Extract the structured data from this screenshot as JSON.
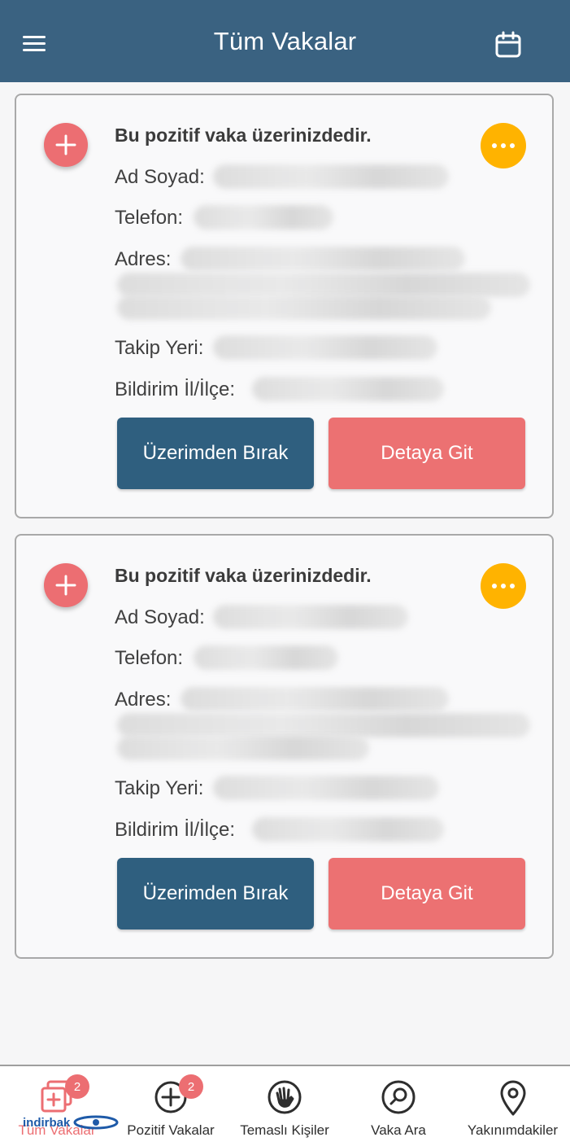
{
  "header": {
    "title": "Tüm Vakalar"
  },
  "cases": [
    {
      "status": "Bu pozitif vaka üzerinizdedir.",
      "labels": {
        "name": "Ad Soyad:",
        "phone": "Telefon:",
        "address": "Adres:",
        "tracking": "Takip Yeri:",
        "notify": "Bildirim İl/İlçe:"
      },
      "release_label": "Üzerimden Bırak",
      "detail_label": "Detaya Git"
    },
    {
      "status": "Bu pozitif vaka üzerinizdedir.",
      "labels": {
        "name": "Ad Soyad:",
        "phone": "Telefon:",
        "address": "Adres:",
        "tracking": "Takip Yeri:",
        "notify": "Bildirim İl/İlçe:"
      },
      "release_label": "Üzerimden Bırak",
      "detail_label": "Detaya Git"
    }
  ],
  "tabs": [
    {
      "label": "Tüm Vakalar",
      "badge": "2",
      "icon": "stacked-plus-icon",
      "active": true
    },
    {
      "label": "Pozitif Vakalar",
      "badge": "2",
      "icon": "circle-plus-icon"
    },
    {
      "label": "Temaslı Kişiler",
      "icon": "hand-icon"
    },
    {
      "label": "Vaka Ara",
      "icon": "search-icon"
    },
    {
      "label": "Yakınımdakiler",
      "icon": "location-pin-icon"
    }
  ],
  "watermark": {
    "text": "indirbak"
  },
  "colors": {
    "header": "#3a6281",
    "accent": "#ec6e72",
    "primary_button": "#2f5f7f",
    "more": "#ffb300"
  }
}
